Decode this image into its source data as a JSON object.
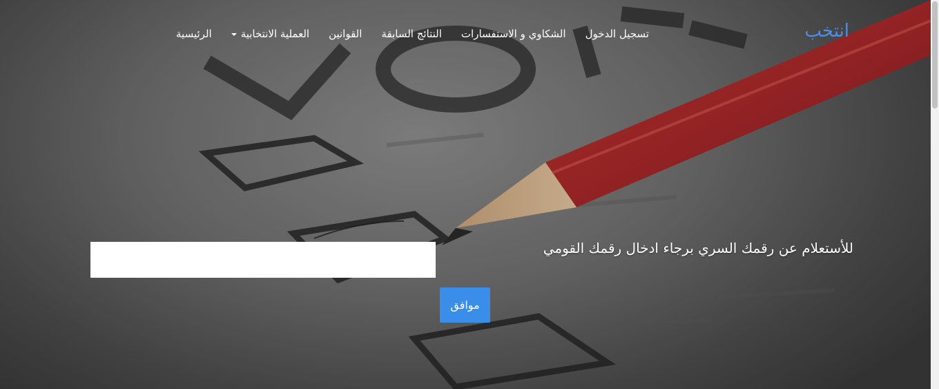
{
  "brand": "انتخب",
  "nav": {
    "items": [
      {
        "label": "الرئيسية"
      },
      {
        "label": "العملية الانتخابية",
        "dropdown": true
      },
      {
        "label": "القوانين"
      },
      {
        "label": "النتائج السابقة"
      },
      {
        "label": "الشكاوي و الاستفسارات"
      },
      {
        "label": "تسجيل الدخول"
      }
    ]
  },
  "hero": {
    "prompt": "للأستعلام عن رقمك السري برجاء ادخال رقمك القومي",
    "input_value": "",
    "submit_label": "موافق"
  },
  "colors": {
    "brand": "#4f8ee6",
    "button": "#3a8eea",
    "pencil": "#a8282a"
  },
  "icons": {
    "dropdown": "caret-down-icon"
  }
}
